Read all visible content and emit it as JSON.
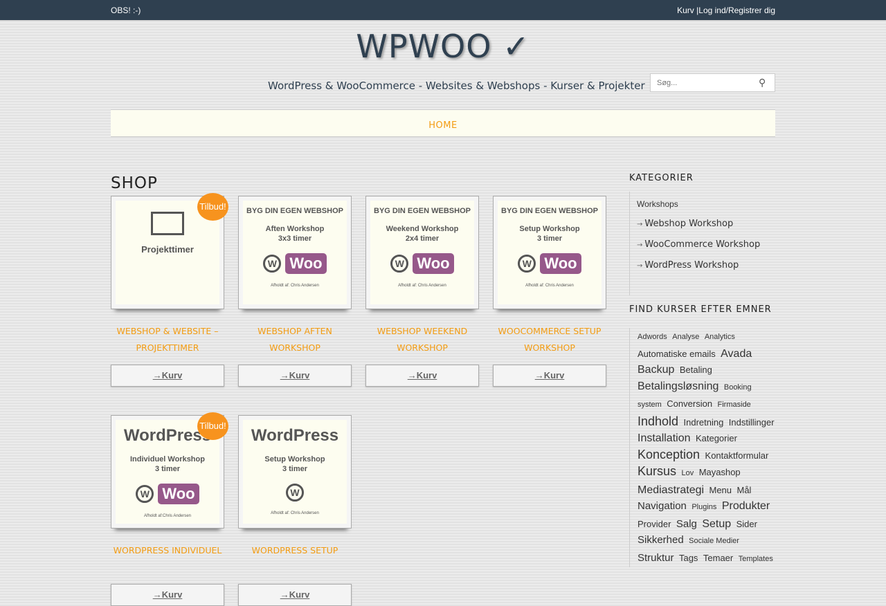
{
  "topbar": {
    "notice": "OBS! :-)",
    "cart": "Kurv",
    "separator": "|",
    "login": "Log ind/Registrer dig"
  },
  "site": {
    "logo": "WPWOO ✓",
    "tagline": "WordPress & WooCommerce - Websites & Webshops - Kurser & Projekter"
  },
  "search": {
    "placeholder": "Søg...",
    "icon": "search-icon"
  },
  "nav": {
    "items": [
      {
        "label": "HOME"
      }
    ]
  },
  "shop": {
    "title": "SHOP",
    "cart_label": "→Kurv",
    "badge": "Tilbud!",
    "products": [
      {
        "title": "WEBSHOP & WEBSITE – PROJEKTTIMER",
        "sale": true,
        "img": {
          "head": "",
          "line1": "Projekttimer",
          "line2": "",
          "woo": false,
          "wp": false,
          "by": ""
        }
      },
      {
        "title": "WEBSHOP AFTEN WORKSHOP",
        "sale": false,
        "img": {
          "head": "BYG DIN EGEN WEBSHOP",
          "line1": "Aften Workshop",
          "line2": "3x3 timer",
          "woo": true,
          "by": "Afholdt af: Chris Andersen"
        }
      },
      {
        "title": "WEBSHOP WEEKEND WORKSHOP",
        "sale": false,
        "img": {
          "head": "BYG DIN EGEN WEBSHOP",
          "line1": "Weekend Workshop",
          "line2": "2x4 timer",
          "woo": true,
          "by": "Afholdt af: Chris Andersen"
        }
      },
      {
        "title": "WOOCOMMERCE SETUP WORKSHOP",
        "sale": false,
        "img": {
          "head": "BYG DIN EGEN WEBSHOP",
          "line1": "Setup Workshop",
          "line2": "3 timer",
          "woo": true,
          "by": "Afholdt af: Chris Andersen"
        }
      },
      {
        "title": "WORDPRESS INDIVIDUEL",
        "sale": true,
        "img": {
          "head": "WordPress",
          "line1": "Individuel Workshop",
          "line2": "3 timer",
          "woo": true,
          "by": "Afholdt af:Chris Andersen"
        }
      },
      {
        "title": "WORDPRESS SETUP",
        "sale": false,
        "img": {
          "head": "WordPress",
          "line1": "Setup Workshop",
          "line2": "3 timer",
          "woo": false,
          "by": "Afholdt af: Chris Andersen"
        }
      }
    ],
    "woo_text": "Woo",
    "wp_text": "W"
  },
  "sidebar": {
    "categories_title": "KATEGORIER",
    "parent": "Workshops",
    "arrow": "→",
    "categories": [
      "Webshop Workshop",
      "WooCommerce Workshop",
      "WordPress Workshop"
    ],
    "tags_title": "FIND KURSER EFTER EMNER",
    "tags": [
      [
        "Adwords",
        11
      ],
      [
        "Analyse",
        11
      ],
      [
        "Analytics",
        11
      ],
      [
        "Automatiske emails",
        13
      ],
      [
        "Avada",
        16
      ],
      [
        "Backup",
        16
      ],
      [
        "Betaling",
        13
      ],
      [
        "Betalingsløsning",
        16
      ],
      [
        "Booking system",
        11
      ],
      [
        "Conversion",
        13
      ],
      [
        "Firmaside",
        11
      ],
      [
        "Indhold",
        18
      ],
      [
        "Indretning",
        13
      ],
      [
        "Indstillinger",
        13
      ],
      [
        "Installation",
        16
      ],
      [
        "Kategorier",
        13
      ],
      [
        "Konception",
        18
      ],
      [
        "Kontaktformular",
        13
      ],
      [
        "Kursus",
        18
      ],
      [
        "Lov",
        11
      ],
      [
        "Mayashop",
        13
      ],
      [
        "Mediastrategi",
        16
      ],
      [
        "Menu",
        13
      ],
      [
        "Mål",
        13
      ],
      [
        "Navigation",
        15
      ],
      [
        "Plugins",
        11
      ],
      [
        "Produkter",
        16
      ],
      [
        "Provider",
        13
      ],
      [
        "Salg",
        15
      ],
      [
        "Setup",
        16
      ],
      [
        "Sider",
        13
      ],
      [
        "Sikkerhed",
        15
      ],
      [
        "Sociale Medier",
        11
      ],
      [
        "Struktur",
        15
      ],
      [
        "Tags",
        13
      ],
      [
        "Temaer",
        13
      ],
      [
        "Templates",
        11
      ]
    ]
  }
}
